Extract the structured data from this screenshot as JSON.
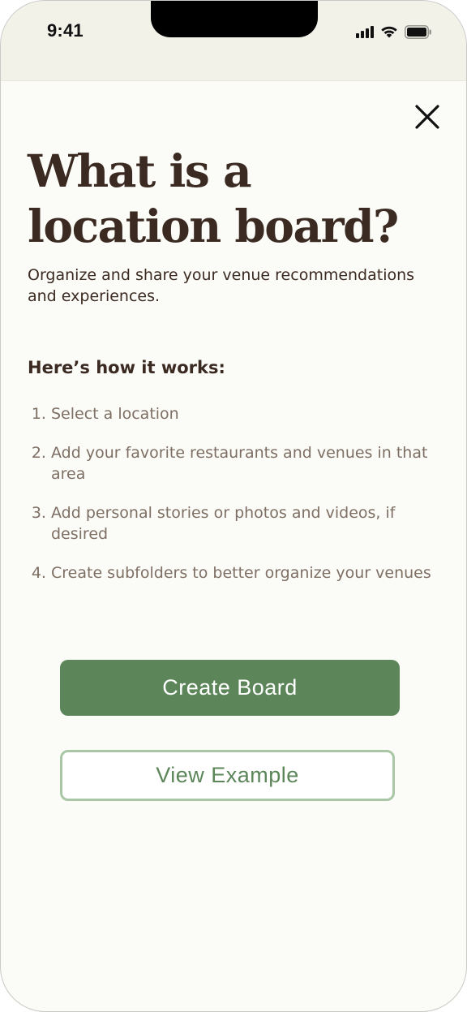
{
  "status_bar": {
    "time": "9:41",
    "icons": [
      "cellular-signal-icon",
      "wifi-icon",
      "battery-icon"
    ]
  },
  "modal": {
    "close_icon": "close-icon",
    "title": "What is a location board?",
    "subtitle": "Organize and share your venue recommendations and experiences.",
    "how_heading": "Here’s how it works:",
    "steps": [
      {
        "number": "1.",
        "text": "Select a location"
      },
      {
        "number": "2.",
        "text": "Add your favorite restaurants and venues in that area"
      },
      {
        "number": "3.",
        "text": "Add personal stories or photos and videos, if desired"
      },
      {
        "number": "4.",
        "text": "Create subfolders to better organize your venues"
      }
    ],
    "primary_button": "Create Board",
    "secondary_button": "View Example"
  },
  "colors": {
    "accent_green": "#5c8659",
    "outline_green": "#a9c6a5",
    "heading_brown": "#3b2a21",
    "body_taupe": "#7e6f64",
    "background": "#fbfbf7"
  }
}
